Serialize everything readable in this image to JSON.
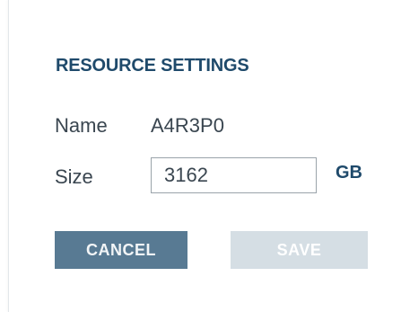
{
  "dialog": {
    "title": "RESOURCE SETTINGS",
    "name_label": "Name",
    "name_value": "A4R3P0",
    "size_label": "Size",
    "size_value": "3162",
    "size_unit": "GB",
    "cancel_label": "CANCEL",
    "save_label": "SAVE"
  },
  "colors": {
    "accent": "#1f4a6b",
    "cancel_bg": "#587a93",
    "save_disabled_bg": "#d5dee4",
    "text": "#3a4650"
  }
}
